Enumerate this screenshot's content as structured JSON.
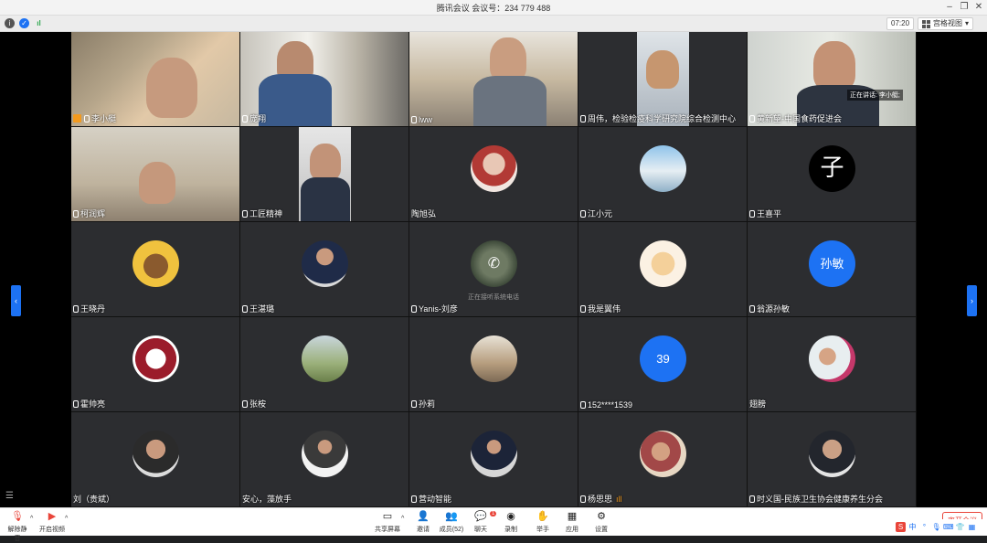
{
  "window": {
    "title": "腾讯会议 会议号：234 779 488"
  },
  "topbar": {
    "timer": "07:20",
    "view_label": "宫格视图"
  },
  "colors": {
    "accent": "#1d72f3",
    "active_border": "#2fa84f",
    "host": "#f39a1e",
    "danger": "#e9453a"
  },
  "speaking": {
    "text": "正在讲话: 李小艇;"
  },
  "tiles": [
    {
      "name": "李小艇",
      "kind": "video"
    },
    {
      "name": "庞翔",
      "kind": "video"
    },
    {
      "name": "lww",
      "kind": "video"
    },
    {
      "name": "周伟，检验检疫科学研究院综合检测中心",
      "kind": "video"
    },
    {
      "name": "黄新望-中国食药促进会",
      "kind": "video"
    },
    {
      "name": "柯润辉",
      "kind": "video"
    },
    {
      "name": "工匠精神",
      "kind": "video"
    },
    {
      "name": "陶旭弘",
      "kind": "avatar"
    },
    {
      "name": "江小元",
      "kind": "avatar"
    },
    {
      "name": "王喜平",
      "kind": "avatar",
      "avatar_text": "子"
    },
    {
      "name": "王晓丹",
      "kind": "avatar"
    },
    {
      "name": "王湛璐",
      "kind": "avatar"
    },
    {
      "name": "Yanis-刘彦",
      "kind": "phone",
      "sub": "正在接听系统电话"
    },
    {
      "name": "我是翼伟",
      "kind": "avatar"
    },
    {
      "name": "翁源孙敏",
      "kind": "initials",
      "avatar_text": "孙敏"
    },
    {
      "name": "霍帅亮",
      "kind": "avatar"
    },
    {
      "name": "张桉",
      "kind": "avatar"
    },
    {
      "name": "孙莉",
      "kind": "avatar"
    },
    {
      "name": "152****1539",
      "kind": "initials",
      "avatar_text": "39"
    },
    {
      "name": "翅膀",
      "kind": "avatar"
    },
    {
      "name": "刘（贵斌）",
      "kind": "avatar"
    },
    {
      "name": "安心，藻放手",
      "kind": "avatar"
    },
    {
      "name": "营动智能",
      "kind": "avatar"
    },
    {
      "name": "杨思思",
      "kind": "avatar"
    },
    {
      "name": "时义国-民族卫生协会健康养生分会",
      "kind": "avatar"
    }
  ],
  "bottom": {
    "unmute": "解除静音",
    "start_video": "开启视频",
    "share": "共享屏幕",
    "invite": "邀请",
    "members": "成员(52)",
    "chat": "聊天",
    "chat_badge": "1",
    "record": "录制",
    "raise_hand": "举手",
    "apps": "应用",
    "settings": "设置",
    "end": "离开会议"
  },
  "ime": {
    "lang": "中"
  }
}
